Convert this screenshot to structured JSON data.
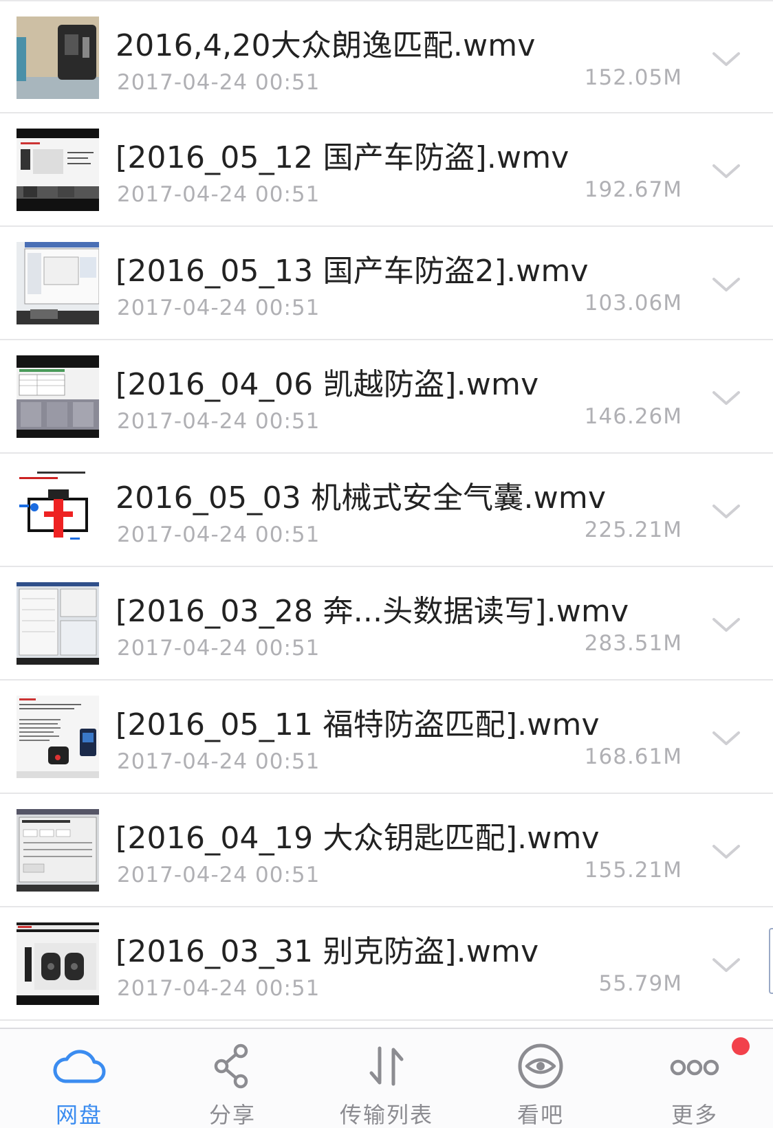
{
  "files": [
    {
      "name": "2016,4,20大众朗逸匹配.wmv",
      "date": "2017-04-24 00:51",
      "size": "152.05M",
      "thumbnail": "video-thumbnail-key-device"
    },
    {
      "name": "[2016_05_12 国产车防盗].wmv",
      "date": "2017-04-24 00:51",
      "size": "192.67M",
      "thumbnail": "video-thumbnail-slides-keys"
    },
    {
      "name": "[2016_05_13 国产车防盗2].wmv",
      "date": "2017-04-24 00:51",
      "size": "103.06M",
      "thumbnail": "video-thumbnail-software-window"
    },
    {
      "name": "[2016_04_06 凯越防盗].wmv",
      "date": "2017-04-24 00:51",
      "size": "146.26M",
      "thumbnail": "video-thumbnail-table-screen"
    },
    {
      "name": "2016_05_03 机械式安全气囊.wmv",
      "date": "2017-04-24 00:51",
      "size": "225.21M",
      "thumbnail": "video-thumbnail-airbag-diagram"
    },
    {
      "name": "[2016_03_28 奔...头数据读写].wmv",
      "date": "2017-04-24 00:51",
      "size": "283.51M",
      "thumbnail": "video-thumbnail-data-software"
    },
    {
      "name": "[2016_05_11 福特防盗匹配].wmv",
      "date": "2017-04-24 00:51",
      "size": "168.61M",
      "thumbnail": "video-thumbnail-ford-document"
    },
    {
      "name": "[2016_04_19 大众钥匙匹配].wmv",
      "date": "2017-04-24 00:51",
      "size": "155.21M",
      "thumbnail": "video-thumbnail-vw-software"
    },
    {
      "name": "[2016_03_31 别克防盗].wmv",
      "date": "2017-04-24 00:51",
      "size": "55.79M",
      "thumbnail": "video-thumbnail-buick-keys"
    }
  ],
  "row_menu_icon": "chevron-down-icon",
  "tabs": [
    {
      "label": "网盘",
      "icon": "cloud-icon",
      "active": true
    },
    {
      "label": "分享",
      "icon": "share-icon",
      "active": false
    },
    {
      "label": "传输列表",
      "icon": "transfer-arrows-icon",
      "active": false
    },
    {
      "label": "看吧",
      "icon": "eye-icon",
      "active": false
    },
    {
      "label": "更多",
      "icon": "more-dots-icon",
      "active": false,
      "badge": true
    }
  ],
  "colors": {
    "accent": "#3b8cf0",
    "tab_inactive": "#8c8c91",
    "badge": "#f2414b",
    "text_primary": "#222222",
    "text_secondary": "#b0b0b4"
  }
}
